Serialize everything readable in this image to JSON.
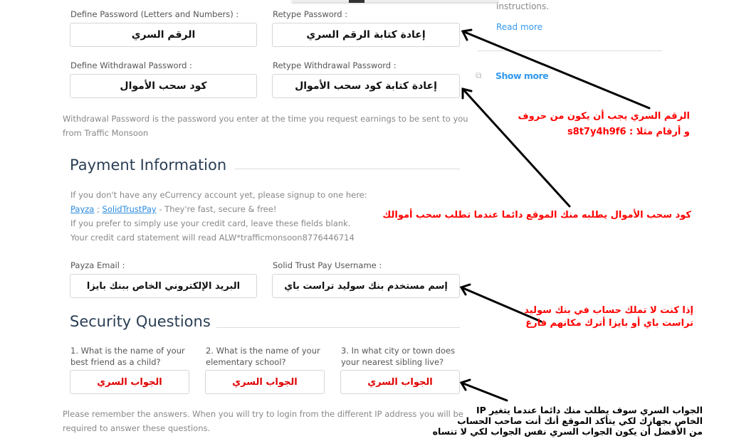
{
  "account": {
    "password_label": "Define Password (Letters and Numbers) :",
    "password_value": "الرقم السري",
    "retype_password_label": "Retype Password :",
    "retype_password_value": "إعادة كتابة الرقم السري",
    "withdrawal_label": "Define Withdrawal Password :",
    "withdrawal_value": "كود سحب الأموال",
    "retype_withdrawal_label": "Retype Withdrawal Password :",
    "retype_withdrawal_value": "إعادة كتابة كود سحب الأموال",
    "withdrawal_note_1": "Withdrawal Password is the password you enter at the time you request earnings to be sent to you",
    "withdrawal_note_2": "from Traffic Monsoon"
  },
  "sidebar": {
    "instructions_text": "instructions.",
    "read_more": "Read more",
    "show_more": "Show more",
    "show_more_icon": "copy-icon"
  },
  "payment": {
    "title": "Payment Information",
    "line1": "If you don't have any eCurrency account yet, please signup to one here:",
    "payza_link": "Payza",
    "separator": " ; ",
    "stp_link": "SolidTrustPay",
    "line2_tail": " - They're fast, secure & free!",
    "line3": "If you prefer to simply use your credit card, leave these fields blank.",
    "line4": "Your credit card statement will read ALW*trafficmonsoon8776446714",
    "payza_email_label": "Payza Email :",
    "payza_email_value": "البريد الإلكتروني الخاص ببنك بايزا",
    "stp_username_label": "Solid Trust Pay Username :",
    "stp_username_value": "إسم مستخدم بنك سوليد تراست باي"
  },
  "security": {
    "title": "Security Questions",
    "questions": [
      {
        "line1": "1. What is the name of your",
        "line2": "best friend as a child?",
        "answer": "الجواب السري"
      },
      {
        "line1": "2. What is the name of your",
        "line2": "elementary school?",
        "answer": "الجواب السري"
      },
      {
        "line1": "3. In what city or town does",
        "line2": "your nearest sibling live?",
        "answer": "الجواب السري"
      }
    ],
    "note_1": "Please remember the answers. When you will try to login from the different IP address you will be",
    "note_2": "required to answer these questions."
  },
  "annotations": {
    "password_hint_1": "الرقم السري يجب أن يكون من حروف",
    "password_hint_2": "و أرقام مثلا : s8t7y4h9f6",
    "withdrawal_hint": "كود سحب الأموال يطلبه منك الموقع دائما عندما تطلب سحب أموالك",
    "bank_hint_1": "إذا كنت لا تملك حساب في بنك سوليد",
    "bank_hint_2": "تراست باي أو بايزا أترك مكانهم فارغ",
    "security_hint_1": "الجواب السري سوف يطلب منك دائما عندما يتغير IP",
    "security_hint_2": "الخاص بجهازك لكي يتأكد الموقع أنك أنت صاحب الحساب",
    "security_hint_3": "من الأفضل أن يكون الجواب السري نفس الجواب لكي لا تنساه"
  }
}
